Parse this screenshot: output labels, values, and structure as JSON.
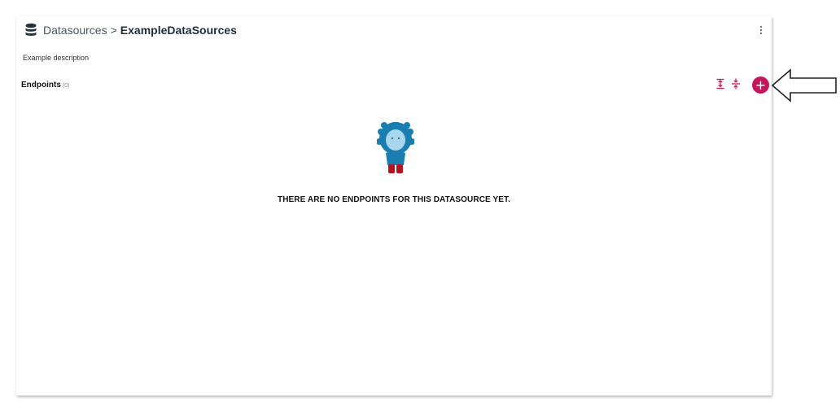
{
  "header": {
    "icon": "database-icon",
    "root_label": "Datasources",
    "separator": ">",
    "current_label": "ExampleDataSources"
  },
  "description": "Example description",
  "endpoints": {
    "title": "Endpoints",
    "count": "(0)",
    "empty_message": "THERE ARE NO ENDPOINTS FOR THIS DATASOURCE YET."
  },
  "toolbar": {
    "expand_icon": "expand-all-icon",
    "collapse_icon": "collapse-all-icon",
    "add_label": "+"
  },
  "annotation": {
    "icon": "left-arrow-icon"
  },
  "colors": {
    "accent": "#c2185b",
    "mascot_blue": "#1a7fb0",
    "mascot_red": "#b3151f"
  }
}
